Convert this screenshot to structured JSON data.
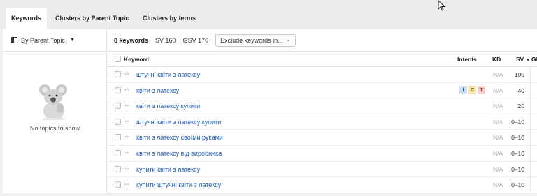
{
  "tabs": [
    {
      "label": "Keywords",
      "active": true
    },
    {
      "label": "Clusters by Parent Topic",
      "active": false
    },
    {
      "label": "Clusters by terms",
      "active": false
    }
  ],
  "sidebar": {
    "group_by_label": "By Parent Topic",
    "empty_text": "No topics to show"
  },
  "toolbar": {
    "keyword_count": "8 keywords",
    "sv": "SV 160",
    "gsv": "GSV 170",
    "exclude_label": "Exclude keywords in..."
  },
  "table": {
    "columns": {
      "keyword": "Keyword",
      "intents": "Intents",
      "kd": "KD",
      "sv": "SV",
      "gl": "GI"
    },
    "rows": [
      {
        "keyword": "штучні квіти з латексу",
        "kd": "N/A",
        "sv": "100",
        "intents": []
      },
      {
        "keyword": "квіти з латексу",
        "kd": "N/A",
        "sv": "40",
        "intents": [
          "I",
          "C",
          "T"
        ]
      },
      {
        "keyword": "квіти з латексу купити",
        "kd": "N/A",
        "sv": "20",
        "intents": []
      },
      {
        "keyword": "штучні квіти з латексу купити",
        "kd": "N/A",
        "sv": "0–10",
        "intents": []
      },
      {
        "keyword": "квіти з латексу своїми руками",
        "kd": "N/A",
        "sv": "0–10",
        "intents": []
      },
      {
        "keyword": "квіти з латексу від виробника",
        "kd": "N/A",
        "sv": "0–10",
        "intents": []
      },
      {
        "keyword": "купити квіти з латексу",
        "kd": "N/A",
        "sv": "0–10",
        "intents": []
      },
      {
        "keyword": "купити штучні квіти з латексу",
        "kd": "N/A",
        "sv": "0–10",
        "intents": []
      }
    ]
  },
  "icons": {
    "cursor": "mouse-cursor-icon",
    "sort": "sort-desc-icon",
    "view": "parent-topic-icon"
  },
  "colors": {
    "link": "#1c5bb5",
    "intent_i": "#c9dcf4",
    "intent_c": "#f6e2a7",
    "intent_t": "#f5cccc"
  }
}
